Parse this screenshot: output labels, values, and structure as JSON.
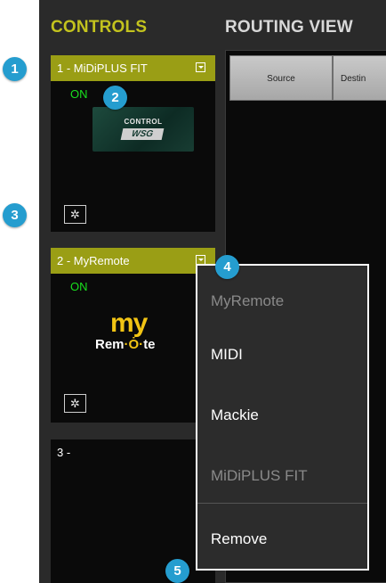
{
  "header": {
    "controls": "CONTROLS",
    "routing": "ROUTING VIEW"
  },
  "slots": [
    {
      "label": "1 - MiDiPLUS FIT",
      "status": "ON",
      "logo_control": "CONTROL",
      "logo_brand": "WSG"
    },
    {
      "label": "2 - MyRemote",
      "status": "ON",
      "logo_my": "my",
      "logo_remote_a": "Rem",
      "logo_remote_b": "te"
    },
    {
      "label": "3 -"
    }
  ],
  "gear_glyph": "✲",
  "routing": {
    "columns": [
      "Source",
      "Destin"
    ]
  },
  "menu": {
    "items": [
      {
        "label": "MyRemote",
        "disabled": true
      },
      {
        "label": "MIDI",
        "disabled": false
      },
      {
        "label": "Mackie",
        "disabled": false
      },
      {
        "label": "MiDiPLUS FIT",
        "disabled": true
      },
      {
        "label": "Remove",
        "disabled": false
      }
    ]
  },
  "badges": [
    "1",
    "2",
    "3",
    "4",
    "5"
  ],
  "colors": {
    "accent": "#9a9e15",
    "header_accent": "#c3c31e",
    "on": "#19e01e",
    "badge": "#259dcf",
    "logo_yellow": "#f2c414"
  }
}
